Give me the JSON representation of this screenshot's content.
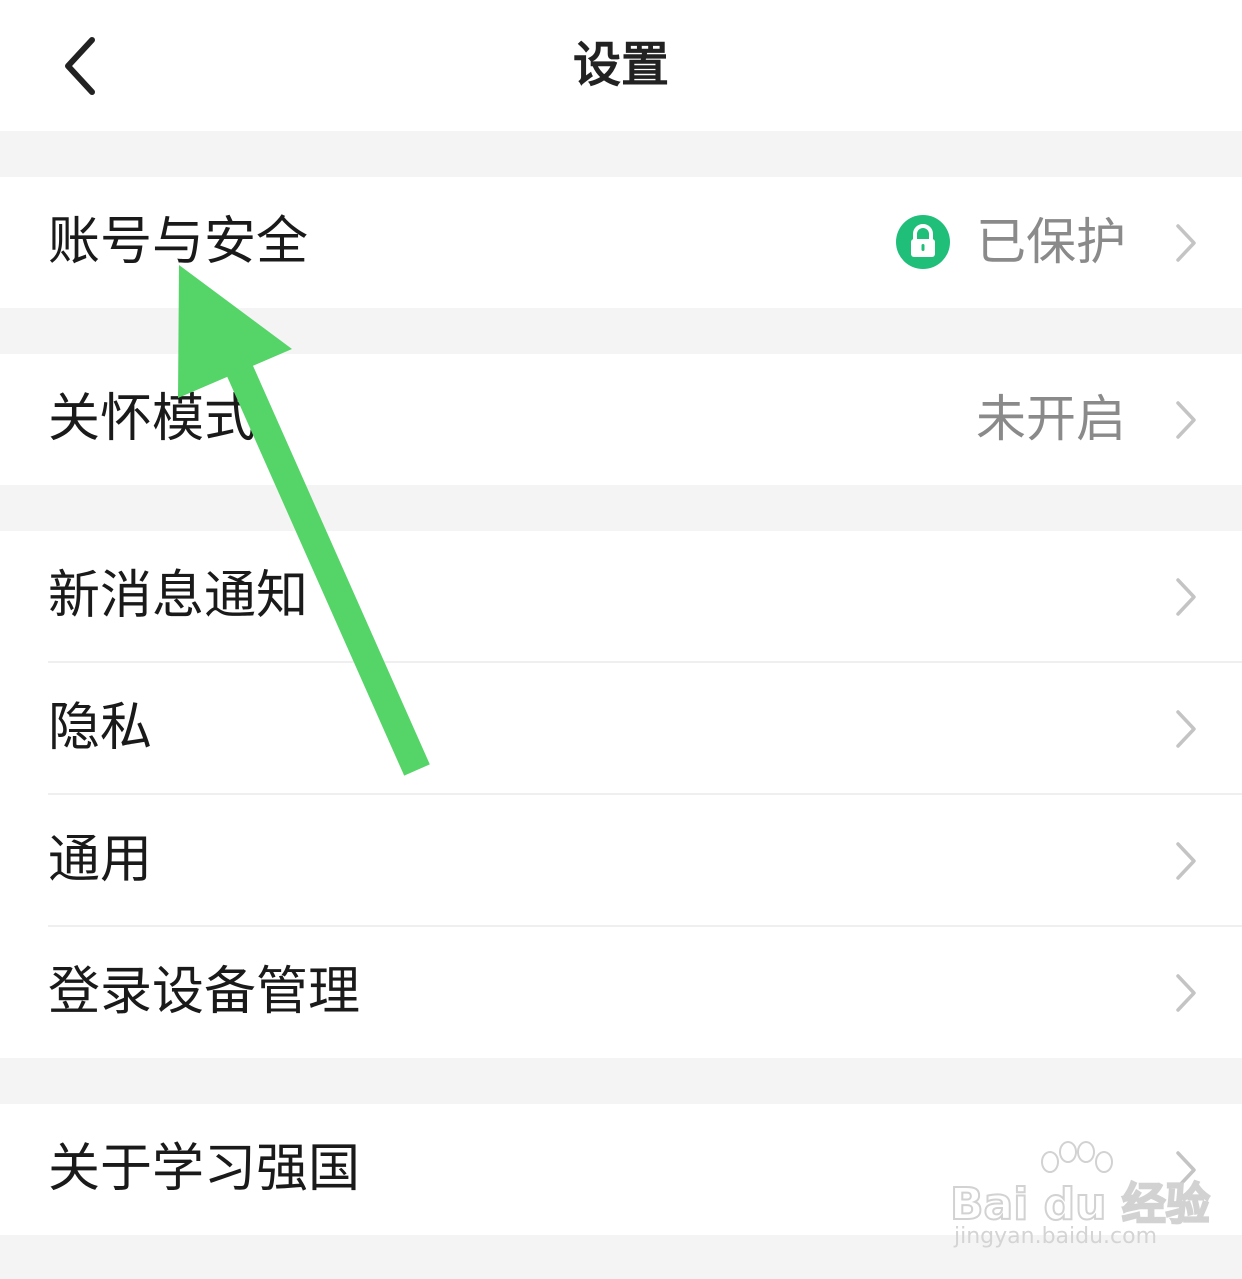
{
  "header": {
    "title": "设置",
    "back_icon": "chevron-left-icon"
  },
  "groups": [
    {
      "items": [
        {
          "label": "账号与安全",
          "value": "已保护",
          "status_icon": "lock-icon",
          "status_color": "#1fbf7a"
        }
      ]
    },
    {
      "items": [
        {
          "label": "关怀模式",
          "value": "未开启"
        }
      ]
    },
    {
      "items": [
        {
          "label": "新消息通知"
        },
        {
          "label": "隐私"
        },
        {
          "label": "通用"
        },
        {
          "label": "登录设备管理"
        }
      ]
    },
    {
      "items": [
        {
          "label": "关于学习强国"
        }
      ]
    }
  ],
  "annotation": {
    "arrow_color": "#55d468"
  },
  "watermark": {
    "logo_text": "Bai du 经验",
    "url_text": "jingyan.baidu.com"
  },
  "colors": {
    "background": "#f4f4f4",
    "card": "#ffffff",
    "primary_text": "#1a1a1a",
    "secondary_text": "#8a8a8a",
    "chevron": "#c4c4c4"
  }
}
